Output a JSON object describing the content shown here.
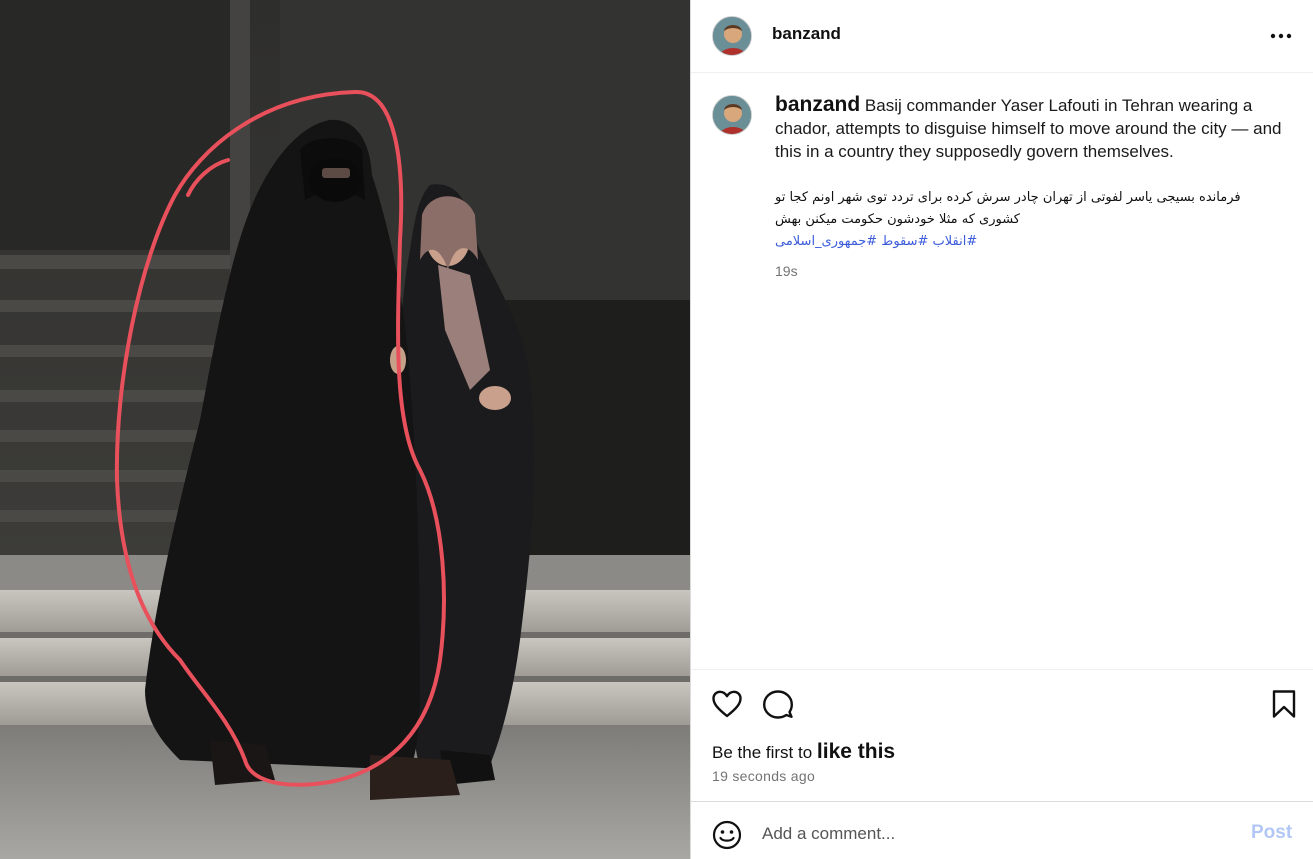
{
  "post": {
    "username": "banzand",
    "image_alt": "Two figures in black chadors walking past steps; one figure circled in red",
    "caption_en": "Basij commander Yaser Lafouti in Tehran wearing a chador, attempts to disguise himself to move around the city — and this in a country they supposedly govern themselves.",
    "caption_fa_line1": "فرمانده بسیجی یاسر لفوتی از تهران چادر سرش کرده برای تردد توی شهر اونم کجا تو",
    "caption_fa_line2": "کشوری که مثلا خودشون حکومت میکنن بهش",
    "caption_tags": "#انقلاب #سقوط #جمهوری_اسلامی",
    "caption_time": "19s",
    "likes_prefix": "Be the first to",
    "likes_link": "like this",
    "timestamp": "19 seconds ago"
  },
  "comment": {
    "placeholder": "Add a comment...",
    "post_label": "Post"
  },
  "icons": {
    "more": "more-options-icon",
    "like": "heart-icon",
    "comment": "comment-bubble-icon",
    "save": "bookmark-icon",
    "emoji": "emoji-icon"
  },
  "colors": {
    "hashtag": "#3b5bdb",
    "post_button": "#b2c7f5",
    "annotation": "#e8505b"
  }
}
